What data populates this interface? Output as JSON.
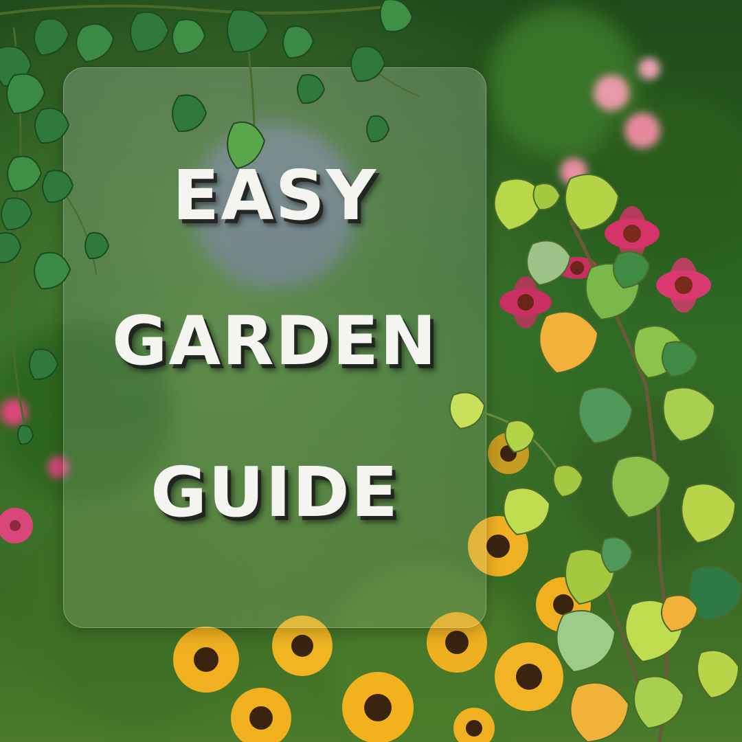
{
  "title": {
    "line1": "EASY",
    "line2": "GARDEN",
    "line3": "GUIDE"
  },
  "colors": {
    "title_text": "#f4f4f0",
    "foliage": "#2f5a22",
    "accent_sunflower": "#f2b21e",
    "accent_coneflower": "#d6336c"
  },
  "icons": [
    "ivy-vine",
    "leafy-vine",
    "sunflower",
    "coneflower",
    "pink-flower"
  ]
}
